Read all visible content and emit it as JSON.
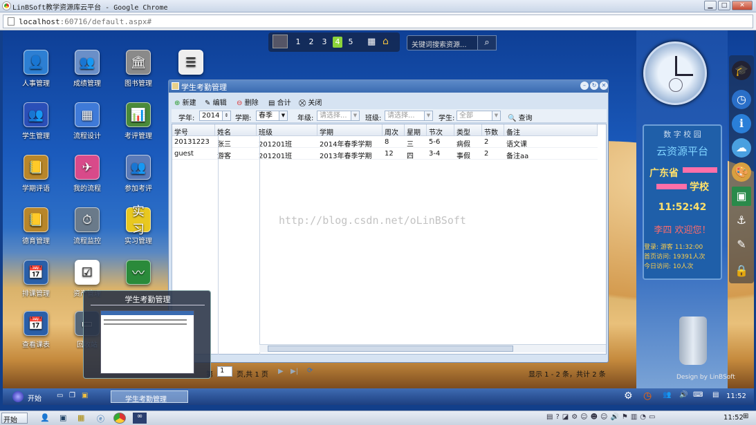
{
  "browser": {
    "title": "LinBSoft教学资源库云平台 - Google Chrome",
    "url_host": "localhost",
    "url_rest": ":60716/default.aspx#"
  },
  "desktop": {
    "icons": [
      {
        "label": "人事管理",
        "color": "#2d7fd3",
        "glyph": "👤"
      },
      {
        "label": "成绩管理",
        "color": "#6a8fc8",
        "glyph": "👥"
      },
      {
        "label": "图书管理",
        "color": "#8a8a8a",
        "glyph": "🏛"
      },
      {
        "label": "",
        "color": "#eeeeee",
        "glyph": "☰"
      },
      {
        "label": "学生管理",
        "color": "#2a4fb8",
        "glyph": "👥"
      },
      {
        "label": "流程设计",
        "color": "#3f7ad8",
        "glyph": "▦"
      },
      {
        "label": "考评管理",
        "color": "#4a8a3a",
        "glyph": "📊"
      },
      {
        "label": "学期评语",
        "color": "#b8862a",
        "glyph": "📒"
      },
      {
        "label": "我的流程",
        "color": "#d84a8a",
        "glyph": "✈"
      },
      {
        "label": "参加考评",
        "color": "#5a7ab8",
        "glyph": "👥"
      },
      {
        "label": "德育管理",
        "color": "#b8862a",
        "glyph": "📒"
      },
      {
        "label": "流程监控",
        "color": "#6a7a8a",
        "glyph": "⏱"
      },
      {
        "label": "实习管理",
        "color": "#e8c820",
        "glyph": "实习"
      },
      {
        "label": "排课管理",
        "color": "#2a5fa8",
        "glyph": "📅"
      },
      {
        "label": "资产管理",
        "color": "#ffffff",
        "glyph": "☑"
      },
      {
        "label": "",
        "color": "#2a8a3a",
        "glyph": "〰"
      },
      {
        "label": "查看课表",
        "color": "#2a5fa8",
        "glyph": "📅"
      },
      {
        "label": "回收站",
        "color": "#556677",
        "glyph": "▭"
      }
    ]
  },
  "topbar": {
    "pages": [
      "1",
      "2",
      "3",
      "4",
      "5"
    ],
    "active_page": "4",
    "search_placeholder": "关键词搜索资源..."
  },
  "info": {
    "header": "数 字 校 园",
    "platform": "云资源平台",
    "school_line1": "广东省",
    "school_line2": "学校",
    "time": "11:52:42",
    "welcome": "李四 欢迎您！",
    "login": "登录: 游客 11:32:00",
    "visits": "首页访问: 19391人次",
    "today": "今日访问: 10人次"
  },
  "footer_brand": "Design by LinBSoft",
  "window": {
    "title": "学生考勤管理",
    "toolbar": [
      "新建",
      "编辑",
      "删除",
      "合计",
      "关闭"
    ],
    "filters": {
      "year_label": "学年:",
      "year_value": "2014",
      "term_label": "学期:",
      "term_value": "春季",
      "grade_label": "年级:",
      "grade_value": "请选择...",
      "class_label": "班级:",
      "class_value": "请选择...",
      "student_label": "学生:",
      "student_value": "全部",
      "query": "查询"
    },
    "columns": [
      "学号",
      "姓名",
      "班级",
      "学期",
      "周次",
      "星期",
      "节次",
      "类型",
      "节数",
      "备注"
    ],
    "rows": [
      [
        "20131223",
        "张三",
        "201201班",
        "2014年春季学期",
        "8",
        "三",
        "5-6",
        "病假",
        "2",
        "语文课"
      ],
      [
        "guest",
        "游客",
        "201201班",
        "2013年春季学期",
        "12",
        "四",
        "3-4",
        "事假",
        "2",
        "备注aa"
      ]
    ],
    "pager": {
      "page_prefix": "第",
      "page": "1",
      "page_suffix": "页,共 1 页",
      "summary": "显示 1 - 2 条，共计 2 条"
    }
  },
  "watermark": "http://blog.csdn.net/oLinBSoft",
  "thumbnail_title": "学生考勤管理",
  "taskbar": {
    "start": "开始",
    "task": "学生考勤管理",
    "time": "11:52"
  },
  "os_taskbar": {
    "start": "开始",
    "time": "11:52"
  }
}
